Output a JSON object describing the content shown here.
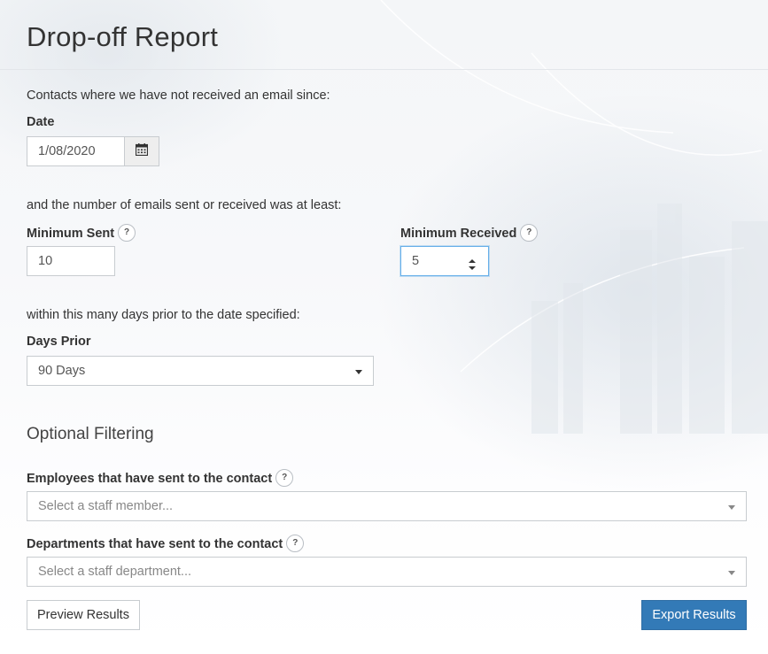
{
  "page": {
    "title": "Drop-off Report"
  },
  "date_section": {
    "intro": "Contacts where we have not received an email since:",
    "label": "Date",
    "value": "1/08/2020"
  },
  "minimums": {
    "intro": "and the number of emails sent or received was at least:",
    "sent": {
      "label": "Minimum Sent",
      "value": "10",
      "help": "?"
    },
    "received": {
      "label": "Minimum Received",
      "value": "5",
      "help": "?"
    }
  },
  "days_prior": {
    "intro": "within this many days prior to the date specified:",
    "label": "Days Prior",
    "selected": "90 Days"
  },
  "optional_filtering": {
    "title": "Optional Filtering",
    "employees": {
      "label": "Employees that have sent to the contact",
      "placeholder": "Select a staff member...",
      "help": "?"
    },
    "departments": {
      "label": "Departments that have sent to the contact",
      "placeholder": "Select a staff department...",
      "help": "?"
    }
  },
  "actions": {
    "preview_label": "Preview Results",
    "export_label": "Export Results"
  },
  "colors": {
    "primary": "#337ab7",
    "focus_border": "#66afe9"
  },
  "icons": {
    "date_picker": "calendar-icon",
    "help": "question-mark-icon",
    "dropdown": "caret-down-icon",
    "number_spinner": "spinner-arrows-icon"
  }
}
